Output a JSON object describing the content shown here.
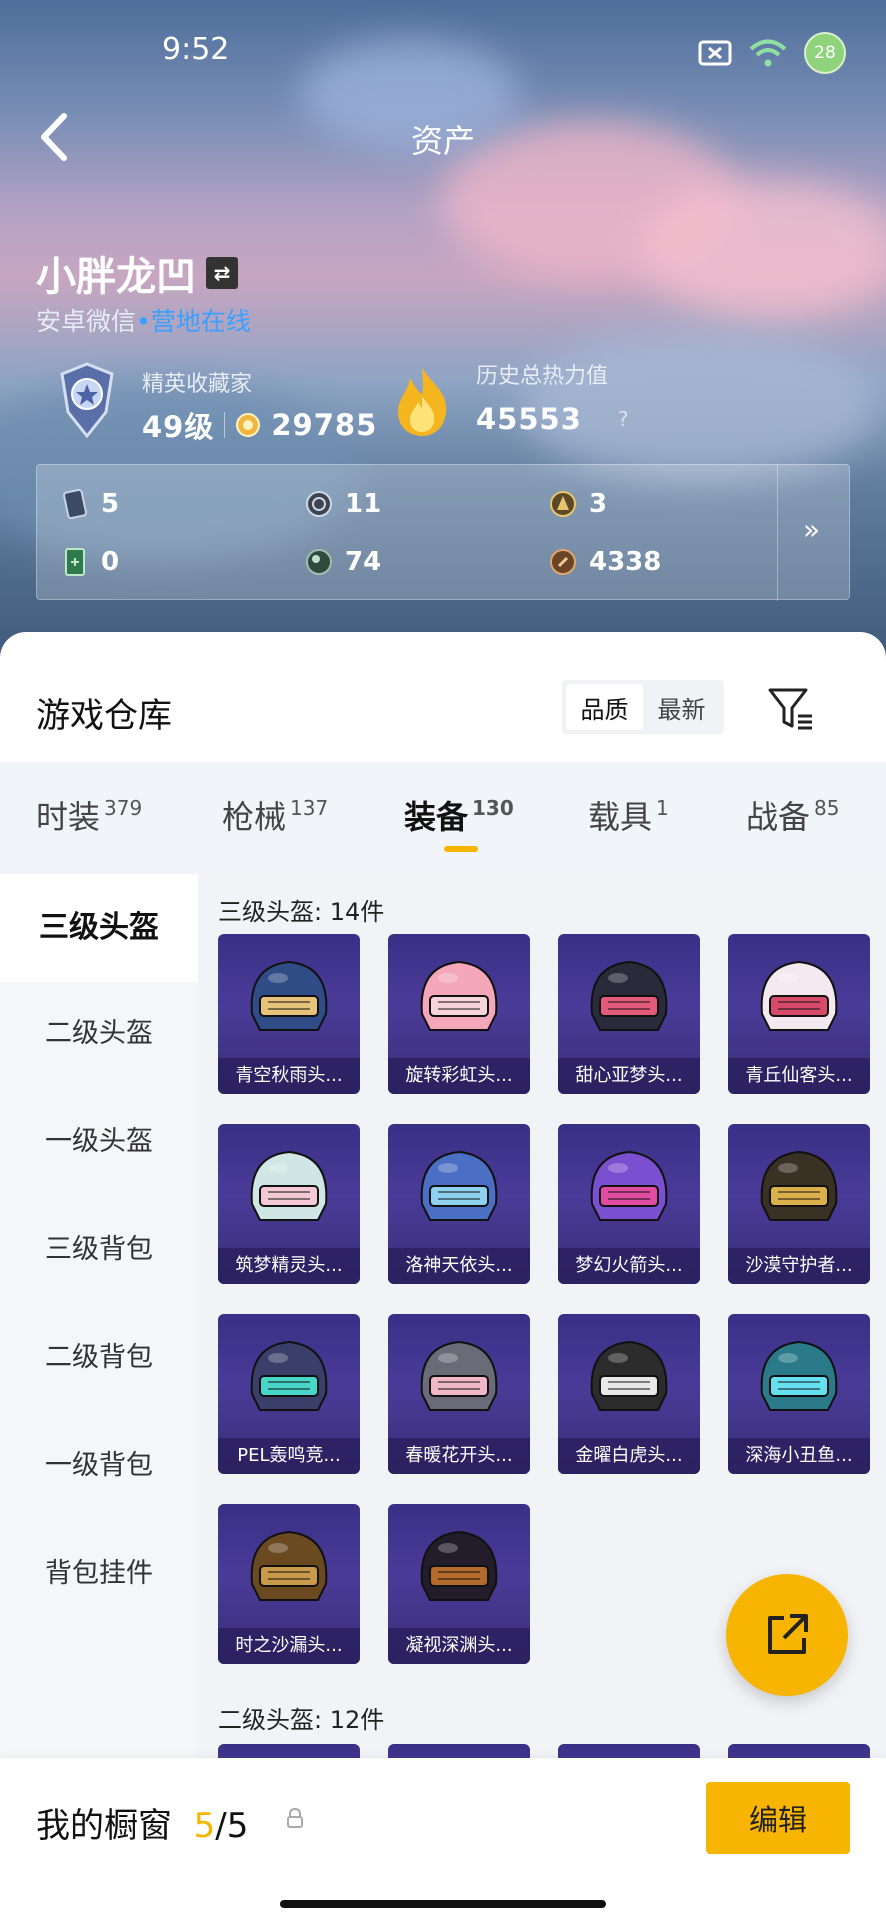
{
  "status": {
    "time": "9:52",
    "battery": "28"
  },
  "header": {
    "title": "资产"
  },
  "profile": {
    "name": "小胖龙凹",
    "platform": "安卓微信",
    "online": "营地在线",
    "collector_label": "精英收藏家",
    "level": "49级",
    "points": "29785",
    "heat_label": "历史总热力值",
    "heat_value": "45553",
    "heat_help": "?"
  },
  "resources": {
    "items": [
      {
        "icon": "card-icon",
        "value": "5"
      },
      {
        "icon": "coin-silver-icon",
        "value": "11"
      },
      {
        "icon": "coin-gold-icon",
        "value": "3"
      },
      {
        "icon": "ticket-icon",
        "value": "0"
      },
      {
        "icon": "orb-icon",
        "value": "74"
      },
      {
        "icon": "bronze-coin-icon",
        "value": "4338"
      }
    ],
    "more": "»"
  },
  "warehouse": {
    "title": "游戏仓库",
    "sort": [
      "品质",
      "最新"
    ],
    "tabs": [
      {
        "label": "时装",
        "count": "379"
      },
      {
        "label": "枪械",
        "count": "137"
      },
      {
        "label": "装备",
        "count": "130"
      },
      {
        "label": "载具",
        "count": "1"
      },
      {
        "label": "战备",
        "count": "85"
      }
    ],
    "side": [
      "三级头盔",
      "二级头盔",
      "一级头盔",
      "三级背包",
      "二级背包",
      "一级背包",
      "背包挂件"
    ],
    "section1": "三级头盔: 14件",
    "section2": "二级头盔: 12件",
    "items": [
      "青空秋雨头...",
      "旋转彩虹头...",
      "甜心亚梦头...",
      "青丘仙客头...",
      "筑梦精灵头...",
      "洛神天依头...",
      "梦幻火箭头...",
      "沙漠守护者...",
      "PEL轰鸣竞...",
      "春暖花开头...",
      "金曜白虎头...",
      "深海小丑鱼...",
      "时之沙漏头...",
      "凝视深渊头..."
    ]
  },
  "bottom": {
    "window_label": "我的橱窗",
    "count": "5",
    "total": "/5",
    "edit": "编辑"
  },
  "colors": {
    "accent": "#f7b400",
    "link": "#3aa0ff",
    "card": "#3a2f86"
  }
}
